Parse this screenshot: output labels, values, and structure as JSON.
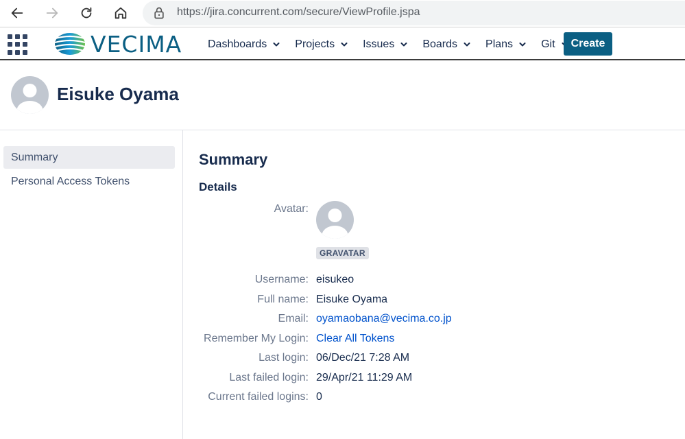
{
  "browser": {
    "url": "https://jira.concurrent.com/secure/ViewProfile.jspa"
  },
  "header": {
    "logo_text": "VECIMA",
    "nav": [
      {
        "label": "Dashboards"
      },
      {
        "label": "Projects"
      },
      {
        "label": "Issues"
      },
      {
        "label": "Boards"
      },
      {
        "label": "Plans"
      },
      {
        "label": "Git"
      }
    ],
    "create_label": "Create"
  },
  "profile": {
    "name": "Eisuke Oyama"
  },
  "sidebar": {
    "items": [
      {
        "label": "Summary",
        "active": true
      },
      {
        "label": "Personal Access Tokens",
        "active": false
      }
    ]
  },
  "main": {
    "title": "Summary",
    "subtitle": "Details",
    "avatar_label": "Avatar:",
    "gravatar_badge": "GRAVATAR",
    "fields": {
      "username": {
        "label": "Username:",
        "value": "eisukeo"
      },
      "full_name": {
        "label": "Full name:",
        "value": "Eisuke Oyama"
      },
      "email": {
        "label": "Email:",
        "value": "oyamaobana@vecima.co.jp"
      },
      "remember_login": {
        "label": "Remember My Login:",
        "value": "Clear All Tokens"
      },
      "last_login": {
        "label": "Last login:",
        "value": "06/Dec/21 7:28 AM"
      },
      "last_failed_login": {
        "label": "Last failed login:",
        "value": "29/Apr/21 11:29 AM"
      },
      "current_failed_logins": {
        "label": "Current failed logins:",
        "value": "0"
      }
    }
  },
  "icons": {
    "back": "arrow-left-icon",
    "forward": "arrow-right-icon",
    "reload": "reload-icon",
    "home": "home-icon",
    "lock": "lock-icon",
    "apps": "grid-icon",
    "avatar": "default-user-avatar-icon"
  },
  "colors": {
    "brand": "#0b5f83",
    "link": "#0052cc",
    "text": "#172b4d",
    "label": "#6b778c"
  }
}
